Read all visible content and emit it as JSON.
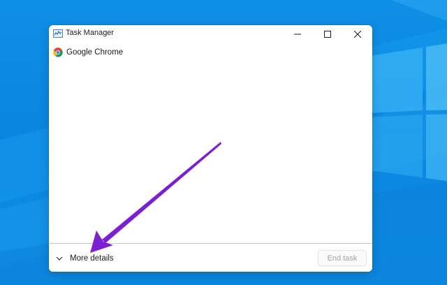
{
  "window": {
    "title": "Task Manager",
    "controls": {
      "minimize_icon": "minimize-icon",
      "maximize_icon": "maximize-icon",
      "close_icon": "close-icon"
    }
  },
  "processes": [
    {
      "name": "Google Chrome",
      "icon": "chrome-icon"
    }
  ],
  "footer": {
    "more_details_label": "More details",
    "more_details_icon": "chevron-down-icon",
    "end_task_label": "End task",
    "end_task_enabled": false
  },
  "annotation": {
    "arrow_color": "#7b1fd1",
    "target": "more-details"
  },
  "colors": {
    "desktop_blue": "#0a86e0",
    "window_bg": "#ffffff",
    "accent_purple": "#7b1fd1"
  }
}
